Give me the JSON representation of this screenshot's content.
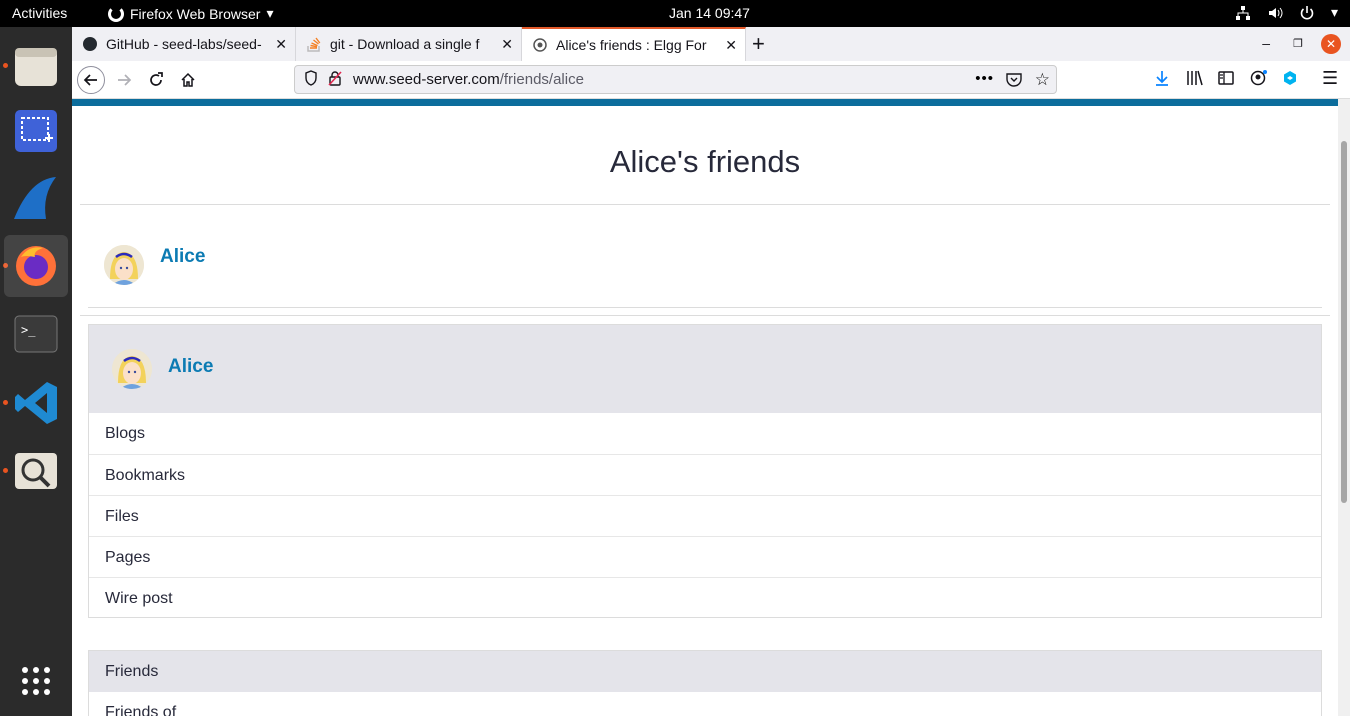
{
  "topbar": {
    "activities": "Activities",
    "app_name": "Firefox Web Browser",
    "clock": "Jan 14  09:47"
  },
  "tabs": [
    {
      "title": "GitHub - seed-labs/seed-"
    },
    {
      "title": "git - Download a single f"
    },
    {
      "title": "Alice's friends : Elgg For"
    }
  ],
  "url": {
    "host": "www.seed-server.com",
    "path": "/friends/alice"
  },
  "page": {
    "title": "Alice's friends",
    "friend_name": "Alice",
    "owner_name": "Alice",
    "menu": [
      "Blogs",
      "Bookmarks",
      "Files",
      "Pages",
      "Wire post"
    ],
    "friends_header": "Friends",
    "friends_of": "Friends of"
  },
  "colors": {
    "accent": "#0c6d9c",
    "link": "#0c7bb3",
    "firefox_tab_accent": "#e35a2b",
    "ubuntu_orange": "#e95420"
  }
}
